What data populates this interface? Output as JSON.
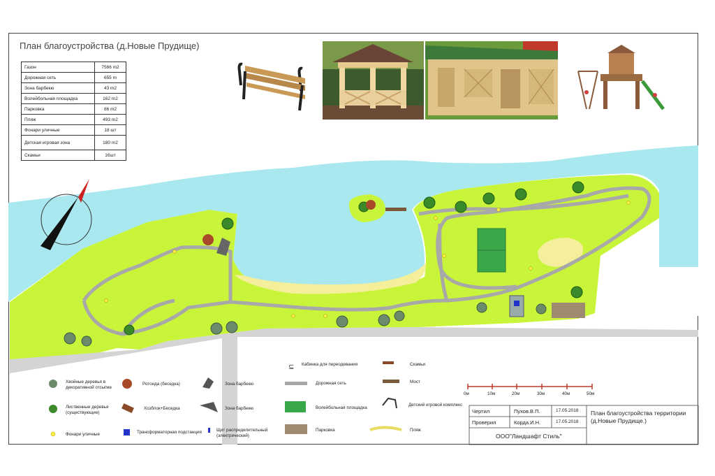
{
  "title": "План благоустройства (д.Новые Прудище)",
  "stats": [
    {
      "k": "Газон",
      "v": "7566 m2"
    },
    {
      "k": "Дорожная сеть",
      "v": "655 m"
    },
    {
      "k": "Зона барбекю",
      "v": "43 m2"
    },
    {
      "k": "Волейбольная площадка",
      "v": "162 m2"
    },
    {
      "k": "Парковка",
      "v": "86 m2"
    },
    {
      "k": "Пляж",
      "v": "493 m2"
    },
    {
      "k": "Фонари уличные",
      "v": "18 шт"
    },
    {
      "k": "Детская игровая зона",
      "v": "180 m2"
    },
    {
      "k": "Скамьи",
      "v": "16шт"
    }
  ],
  "legend": {
    "conifers": "Хвойные деревья в декоративной отсыпке",
    "deciduous": "Лиственные деревья (существующие)",
    "lights": "Фонари уличные",
    "rotunda": "Ротонда (беседка)",
    "shed": "Хозблок+Беседка",
    "transformer": "Трансформаторная подстанция",
    "bbq1": "Зона барбекю",
    "bbq2": "Зона барбекю",
    "panel": "Щит распределительный (электрический)",
    "cabin": "Кабинка для переодевания",
    "roads": "Дорожная сеть",
    "volleyball": "Волейбольная площадка",
    "parking": "Парковка",
    "benches": "Скамьи",
    "bridge": "Мост",
    "playground": "Детский игровой комплекс",
    "beach": "Пляж"
  },
  "scale": {
    "ticks": [
      "0м",
      "10м",
      "20м",
      "30м",
      "40м",
      "50м"
    ]
  },
  "titleblock": {
    "drawn_label": "Чертил",
    "drawn_name": "Пухов.В.П.",
    "drawn_date": "17.05.2018",
    "checked_label": "Проверил",
    "checked_name": "Корда.И.Н.",
    "checked_date": "17.05.2018",
    "company": "ООО\"Ландшафт Стиль\"",
    "plan_title": "План благоустройства территории (д.Новые Прудище.)"
  },
  "colors": {
    "lawn": "#c8f53a",
    "water": "#a9e8ee",
    "sand": "#f5ee9a",
    "road": "#a8a8a8",
    "volley": "#3aa84a",
    "parking": "#9e8a70"
  }
}
